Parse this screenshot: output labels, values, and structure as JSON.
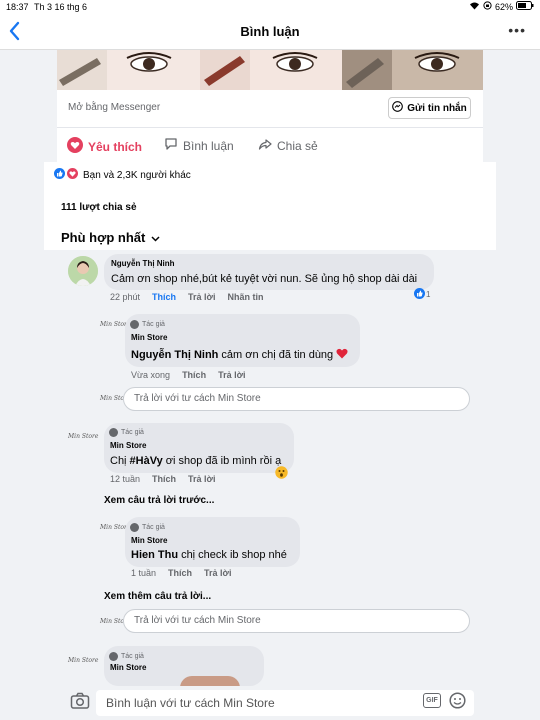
{
  "status": {
    "time": "18:37",
    "date": "Th 3 16 thg 6",
    "battery": "62%"
  },
  "nav": {
    "title": "Bình luận"
  },
  "post": {
    "messenger_label": "Mở bằng Messenger",
    "send_message_label": "Gửi tin nhắn",
    "actions": {
      "like": "Yêu thích",
      "comment": "Bình luận",
      "share": "Chia sẻ"
    }
  },
  "stats": {
    "reactions": "Bạn và 2,3K người khác",
    "shares": "111 lượt chia sẻ",
    "sort": "Phù hợp nhất"
  },
  "comments": {
    "c1": {
      "author": "Nguyễn Thị Ninh",
      "text": "Cảm ơn shop nhé,bút kẻ tuyệt vời nun. Sẽ ủng hộ shop dài dài",
      "time": "22 phút",
      "like": "Thích",
      "reply": "Trả lời",
      "see": "Nhãn tin",
      "reaction_count": "1"
    },
    "r1": {
      "badge": "Tác giả",
      "author": "Min Store",
      "mention": "Nguyễn Thị Ninh",
      "text": "cảm ơn chị đã tin dùng",
      "time": "Vừa xong",
      "like": "Thích",
      "reply": "Trả lời"
    },
    "reply_input_1": "Trả lời với tư cách Min Store",
    "r2": {
      "badge": "Tác giả",
      "author": "Min Store",
      "prefix": "Chị",
      "mention": "#HàVy",
      "text": "ơi shop đã ib mình rồi ạ",
      "time": "12 tuần",
      "like": "Thích",
      "reply": "Trả lời"
    },
    "see_previous": "Xem câu trả lời trước...",
    "r3": {
      "badge": "Tác giả",
      "author": "Min Store",
      "mention": "Hien Thu",
      "text": "chị check ib shop nhé",
      "time": "1 tuần",
      "like": "Thích",
      "reply": "Trả lời"
    },
    "see_more": "Xem thêm câu trả lời...",
    "reply_input_2": "Trả lời với tư cách Min Store",
    "r4": {
      "badge": "Tác giả",
      "author": "Min Store"
    },
    "avatar_text": "Min Store"
  },
  "composer": {
    "placeholder": "Bình luận với tư cách Min Store",
    "gif": "GIF"
  },
  "colors": {
    "accent": "#1877f2",
    "like_red": "#e4405f",
    "bg": "#f0f2f5"
  }
}
